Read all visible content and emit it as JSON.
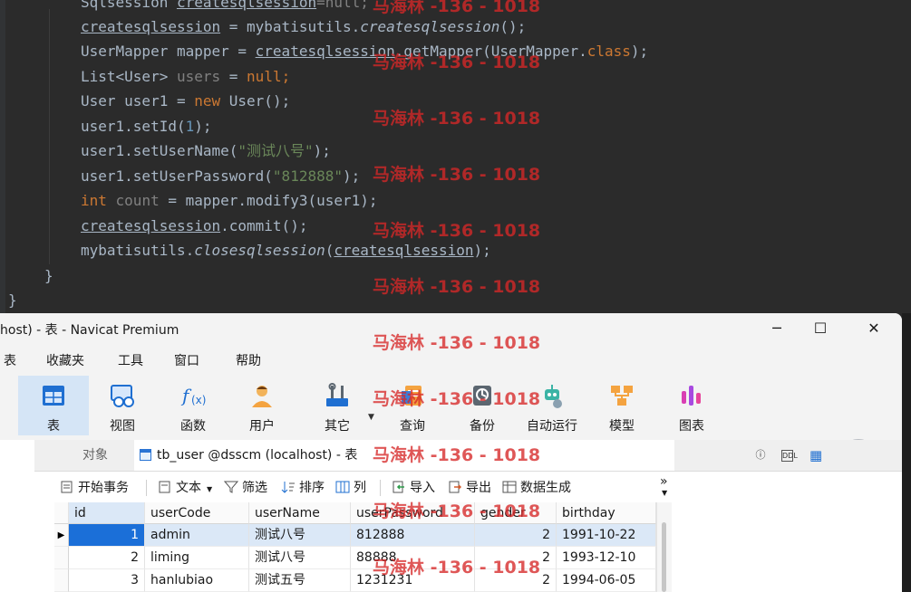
{
  "editor": {
    "lines": {
      "l0": {
        "a": "Sqlsession ",
        "b": "createsqlsession",
        "c": "=null;"
      },
      "l1": {
        "a": "createsqlsession",
        "b": " = mybatisutils.",
        "c": "createsqlsession",
        "d": "();"
      },
      "l2": {
        "a": "UserMapper mapper = ",
        "b": "createsqlsession",
        "c": ".getMapper(UserMapper.",
        "d": "class",
        "e": ");"
      },
      "l3": {
        "a": "List<User> ",
        "b": "users",
        "c": " = ",
        "d": "null",
        "e": ";"
      },
      "l4": {
        "a": "User user1 = ",
        "b": "new",
        "c": " User();"
      },
      "l5": {
        "a": "user1.setId(",
        "b": "1",
        "c": ");"
      },
      "l6": {
        "a": "user1.setUserName(",
        "b": "\"测试八号\"",
        "c": ");"
      },
      "l7": {
        "a": "user1.setUserPassword(",
        "b": "\"812888\"",
        "c": ");"
      },
      "l8": {
        "a": "int",
        "b": " count",
        "c": " = mapper.modify3(user1);"
      },
      "l9": {
        "a": "createsqlsession",
        "b": ".commit();"
      },
      "l10": {
        "a": "mybatisutils.",
        "b": "closesqlsession",
        "c": "(",
        "d": "createsqlsession",
        "e": ");"
      },
      "l11": {
        "a": "}"
      },
      "l12": {
        "a": "}"
      }
    }
  },
  "navicat": {
    "title": "host) - 表 - Navicat Premium",
    "window_buttons": {
      "minimize": "─",
      "maximize": "☐",
      "close": "✕"
    },
    "menu": [
      "表",
      "收藏夹",
      "工具",
      "窗口",
      "帮助"
    ],
    "toolbar": [
      "表",
      "视图",
      "函数",
      "用户",
      "其它",
      "查询",
      "备份",
      "自动运行",
      "模型",
      "图表"
    ],
    "tabs": {
      "objects": "对象",
      "table": "tb_user @dsscm (localhost) - 表"
    },
    "subtoolbar": {
      "begin_transaction": "开始事务",
      "text": "文本",
      "filter": "筛选",
      "sort": "排序",
      "columns": "列",
      "import": "导入",
      "export": "导出",
      "data_gen": "数据生成",
      "more": "»"
    },
    "grid": {
      "columns": [
        "id",
        "userCode",
        "userName",
        "userPassword",
        "gender",
        "birthday"
      ],
      "rows": [
        [
          "1",
          "admin",
          "测试八号",
          "812888",
          "2",
          "1991-10-22"
        ],
        [
          "2",
          "liming",
          "测试八号",
          "88888",
          "2",
          "1993-12-10"
        ],
        [
          "3",
          "hanlubiao",
          "测试五号",
          "1231231",
          "2",
          "1994-06-05"
        ]
      ]
    }
  },
  "watermark": "马海林 -136 - 1018",
  "colors": {
    "editor_bg": "#2b2b2b",
    "keyword": "#cc7832",
    "string": "#6a8759",
    "number": "#6897bb",
    "selection": "#1b6fd8",
    "watermark": "#d62828"
  }
}
